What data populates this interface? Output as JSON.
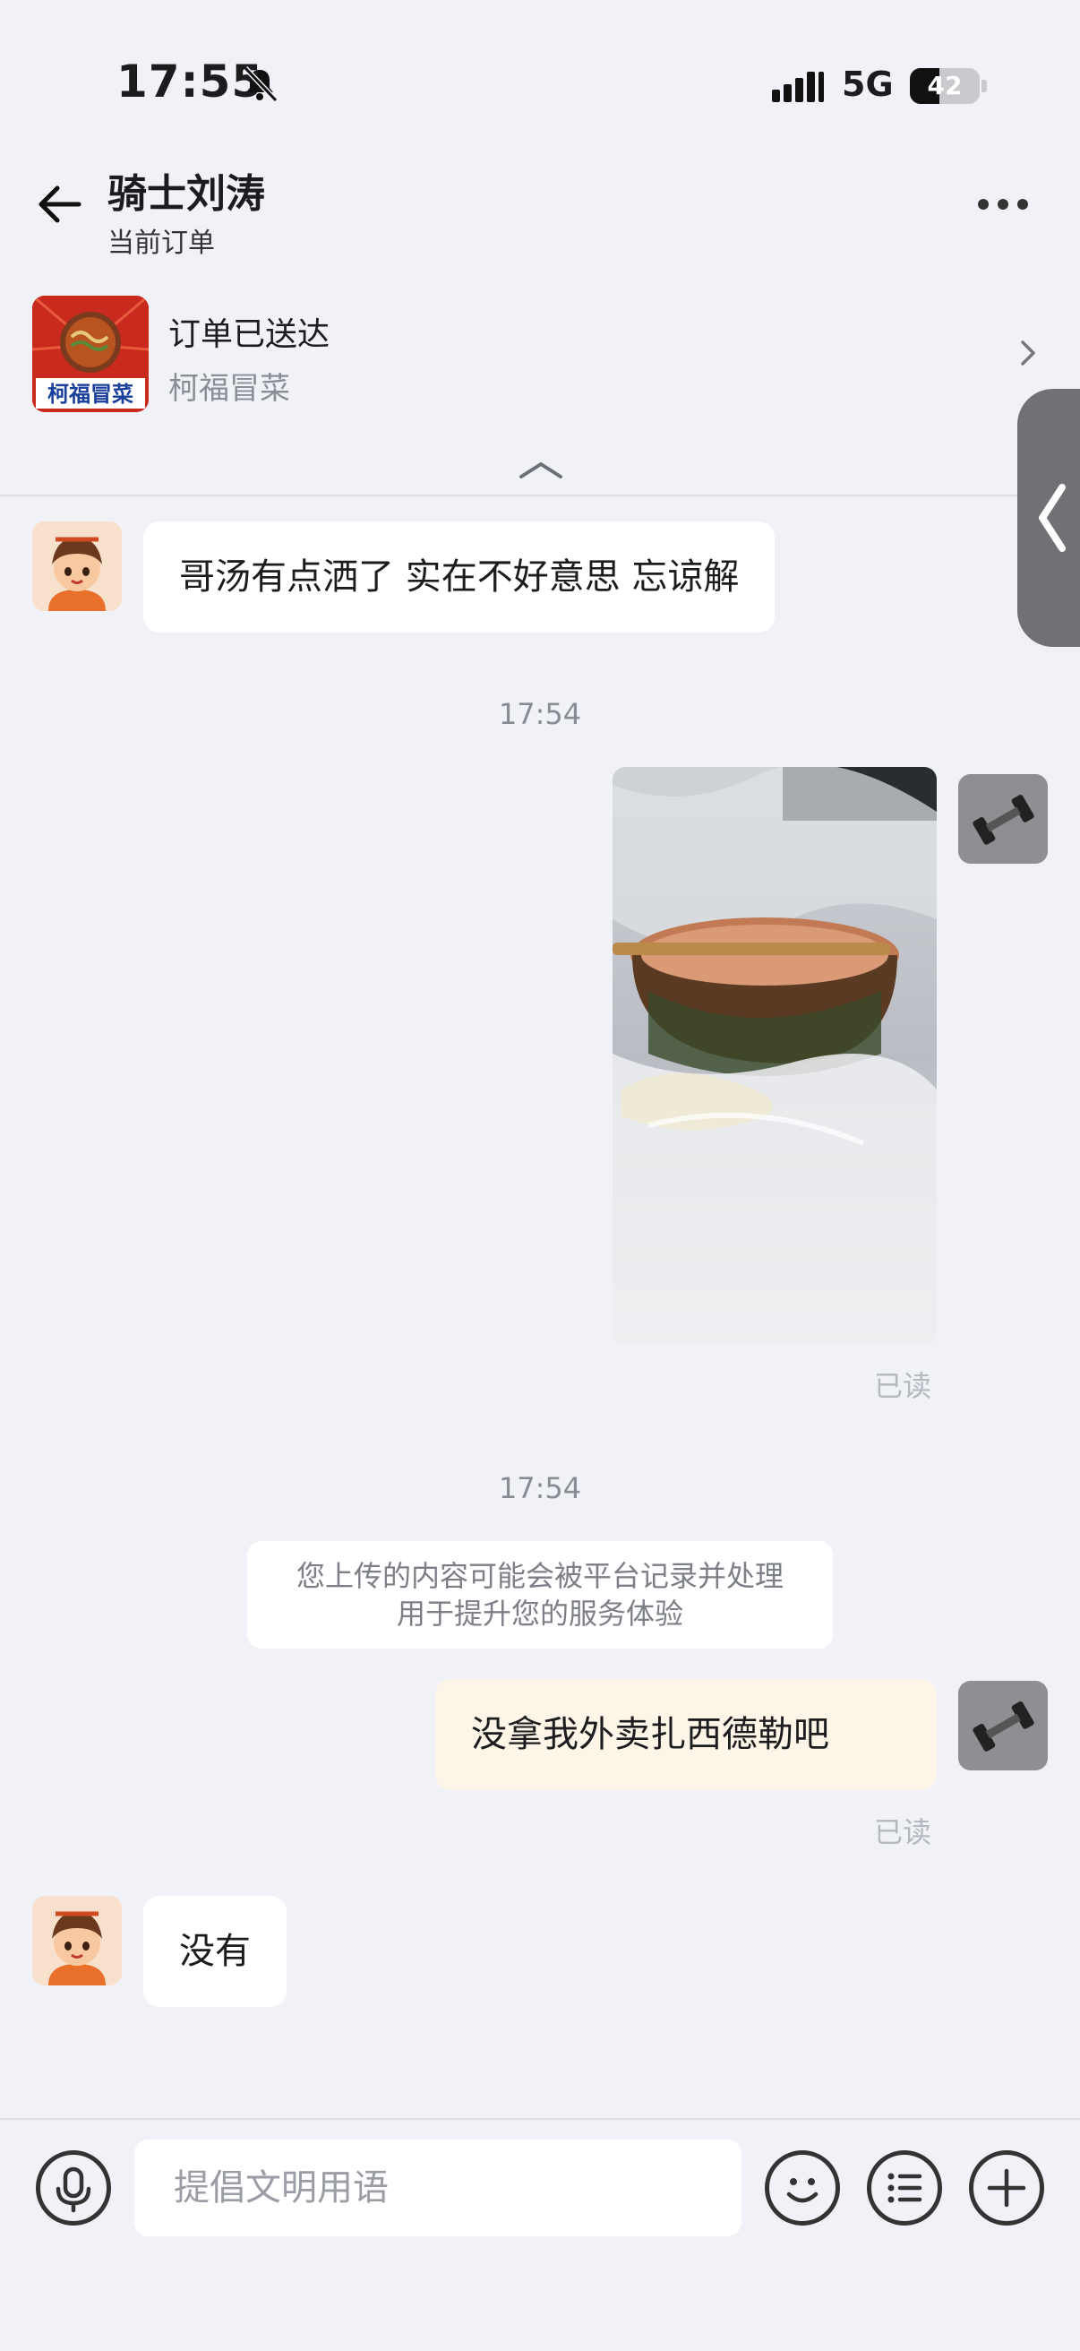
{
  "status_bar": {
    "time": "17:55",
    "network": "5G",
    "battery": "42"
  },
  "header": {
    "title": "骑士刘涛",
    "subtitle": "当前订单"
  },
  "order": {
    "status": "订单已送达",
    "shop_name": "柯福冒菜",
    "logo_text": "柯福冒菜"
  },
  "messages": {
    "rider_1": "哥汤有点洒了 实在不好意思 忘谅解",
    "time_1": "17:54",
    "read_1": "已读",
    "time_2": "17:54",
    "notice_line1": "您上传的内容可能会被平台记录并处理",
    "notice_line2": "用于提升您的服务体验",
    "self_1": "没拿我外卖扎西德勒吧",
    "read_2": "已读",
    "rider_2": "没有"
  },
  "input": {
    "placeholder": "提倡文明用语"
  },
  "colors": {
    "background": "#f0f2f7",
    "self_bubble": "#fdf6e8",
    "logo_red": "#c92a1e"
  }
}
